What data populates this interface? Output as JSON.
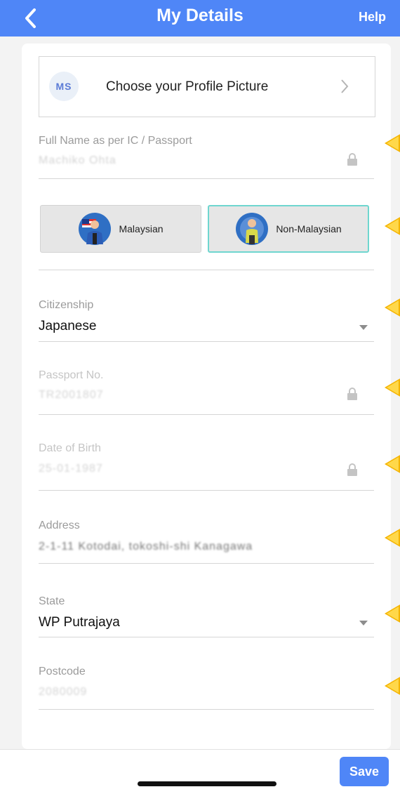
{
  "header": {
    "title": "My Details",
    "help_label": "Help",
    "back_icon": "chevron-left-icon",
    "color": "#4f86f7"
  },
  "profile": {
    "avatar_initials": "MS",
    "label": "Choose your Profile Picture",
    "chevron_icon": "chevron-right-icon"
  },
  "full_name": {
    "label": "Full Name as per IC / Passport",
    "value": "Machiko Ohta",
    "locked": true
  },
  "nationality": {
    "options": [
      {
        "label": "Malaysian",
        "icon": "malaysian-person-icon",
        "selected": false
      },
      {
        "label": "Non-Malaysian",
        "icon": "non-malaysian-person-icon",
        "selected": true
      }
    ],
    "selected_border_color": "#6fd6cf"
  },
  "citizenship": {
    "label": "Citizenship",
    "value": "Japanese"
  },
  "passport": {
    "label": "Passport No.",
    "value": "TR2001807",
    "locked": true
  },
  "dob": {
    "label": "Date of Birth",
    "value": "25-01-1987",
    "locked": true
  },
  "address": {
    "label": "Address",
    "value": "2-1-11 Kotodai, tokoshi-shi Kanagawa"
  },
  "state": {
    "label": "State",
    "value": "WP Putrajaya"
  },
  "postcode": {
    "label": "Postcode",
    "value": "2080009"
  },
  "footer": {
    "save_label": "Save"
  },
  "accent_colors": {
    "primary": "#4f86f7",
    "marker": "#f5b400"
  }
}
